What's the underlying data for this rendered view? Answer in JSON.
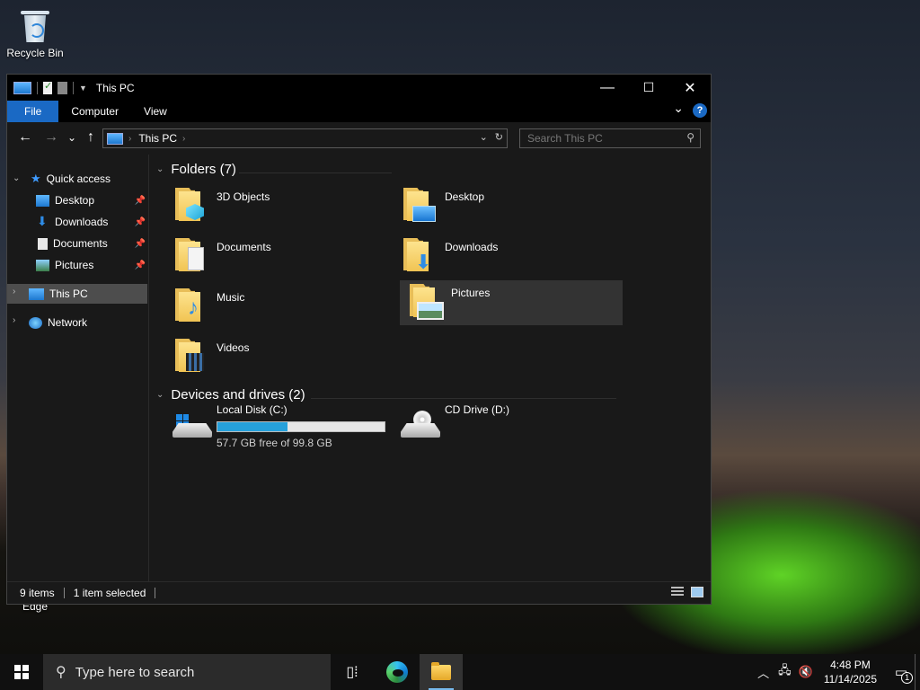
{
  "desktop": {
    "recycle_bin_label": "Recycle Bin",
    "edge_label": "Edge"
  },
  "window": {
    "title": "This PC",
    "minimize_glyph": "—",
    "maximize_glyph": "☐",
    "close_glyph": "✕"
  },
  "ribbon": {
    "tabs": [
      "File",
      "Computer",
      "View"
    ],
    "expand_glyph": "⌄",
    "help_glyph": "?"
  },
  "nav": {
    "back_glyph": "←",
    "forward_glyph": "→",
    "recent_glyph": "⌄",
    "up_glyph": "↑",
    "address_text": "This PC",
    "address_separator": "›",
    "search_placeholder": "Search This PC"
  },
  "sidebar": {
    "quick_access": "Quick access",
    "items": [
      "Desktop",
      "Downloads",
      "Documents",
      "Pictures"
    ],
    "this_pc": "This PC",
    "network": "Network"
  },
  "content": {
    "folders_header": "Folders (7)",
    "folders": [
      "3D Objects",
      "Desktop",
      "Documents",
      "Downloads",
      "Music",
      "Pictures",
      "Videos"
    ],
    "drives_header": "Devices and drives (2)",
    "drives": [
      {
        "name": "Local Disk (C:)",
        "free_text": "57.7 GB free of 99.8 GB",
        "used_fraction": 0.42
      },
      {
        "name": "CD Drive (D:)"
      }
    ]
  },
  "status": {
    "item_count": "9 items",
    "selection": "1 item selected"
  },
  "taskbar": {
    "search_placeholder": "Type here to search",
    "time": "4:48 PM",
    "date": "11/14/2025",
    "notification_count": "1"
  },
  "colors": {
    "accent": "#1a69c4",
    "usage_bar": "#26a0da",
    "folder_yellow": "#f1c453"
  }
}
